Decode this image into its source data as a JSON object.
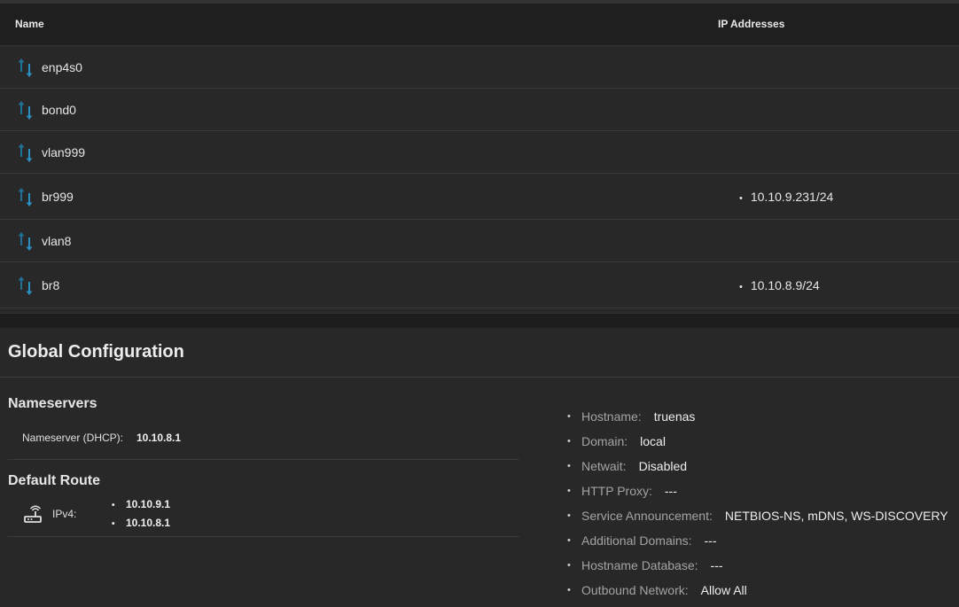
{
  "table": {
    "headers": {
      "name": "Name",
      "ip": "IP Addresses"
    },
    "rows": [
      {
        "name": "enp4s0",
        "ip": ""
      },
      {
        "name": "bond0",
        "ip": ""
      },
      {
        "name": "vlan999",
        "ip": ""
      },
      {
        "name": "br999",
        "ip": "10.10.9.231/24"
      },
      {
        "name": "vlan8",
        "ip": ""
      },
      {
        "name": "br8",
        "ip": "10.10.8.9/24"
      }
    ],
    "row_icon": "swap-vertical-icon",
    "icon_color_up": "#1f6f96",
    "icon_color_down": "#2b8fc2"
  },
  "global": {
    "title": "Global Configuration",
    "nameservers": {
      "title": "Nameservers",
      "label": "Nameserver (DHCP):",
      "value": "10.10.8.1"
    },
    "default_route": {
      "title": "Default Route",
      "icon": "router-icon",
      "label": "IPv4:",
      "values": [
        "10.10.9.1",
        "10.10.8.1"
      ]
    },
    "settings": [
      {
        "key": "Hostname:",
        "value": "truenas"
      },
      {
        "key": "Domain:",
        "value": "local"
      },
      {
        "key": "Netwait:",
        "value": "Disabled"
      },
      {
        "key": "HTTP Proxy:",
        "value": "---"
      },
      {
        "key": "Service Announcement:",
        "value": "NETBIOS-NS, mDNS, WS-DISCOVERY"
      },
      {
        "key": "Additional Domains:",
        "value": "---"
      },
      {
        "key": "Hostname Database:",
        "value": "---"
      },
      {
        "key": "Outbound Network:",
        "value": "Allow All"
      }
    ]
  },
  "colors": {
    "background": "#282828",
    "header_bg": "#1f1f1f",
    "divider": "#3a3a3a",
    "muted_text": "#a3a3a3"
  }
}
